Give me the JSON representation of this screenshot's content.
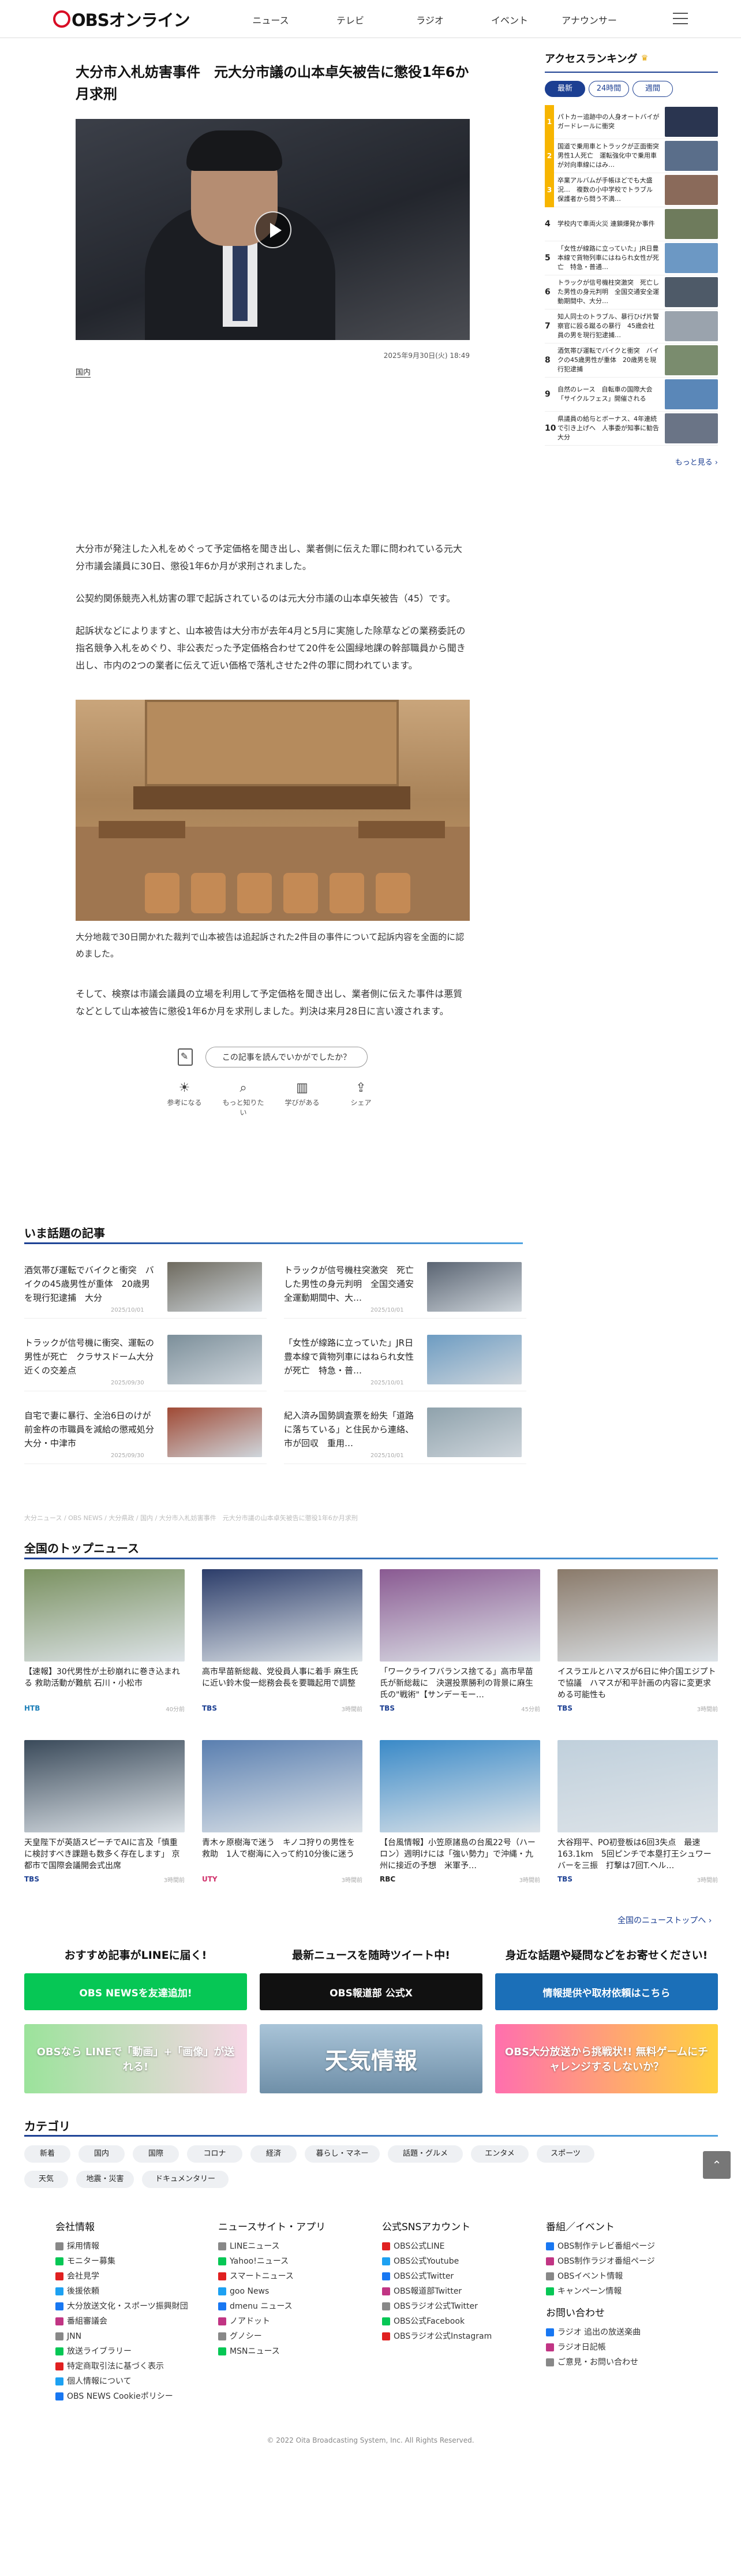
{
  "header": {
    "logo": "OBSオンライン",
    "nav": [
      "ニュース",
      "テレビ",
      "ラジオ",
      "イベント",
      "アナウンサー"
    ]
  },
  "article": {
    "title": "大分市入札妨害事件　元大分市議の山本卓矢被告に懲役1年6か月求刑",
    "date": "2025年9月30日(火) 18:49",
    "category": "国内",
    "paragraphs": [
      "大分市が発注した入札をめぐって予定価格を聞き出し、業者側に伝えた罪に問われている元大分市議会議員に30日、懲役1年6か月が求刑されました。",
      "公契約関係競売入札妨害の罪で起訴されているのは元大分市議の山本卓矢被告（45）です。",
      "起訴状などによりますと、山本被告は大分市が去年4月と5月に実施した除草などの業務委託の指名競争入札をめぐり、非公表だった予定価格合わせて20件を公園緑地課の幹部職員から聞き出し、市内の2つの業者に伝えて近い価格で落札させた2件の罪に問われています。"
    ],
    "caption": "大分地裁で30日開かれた裁判で山本被告は追起訴された2件目の事件について起訴内容を全面的に認めました。",
    "paragraph_last": "そして、検察は市議会議員の立場を利用して予定価格を聞き出し、業者側に伝えた事件は悪質などとして山本被告に懲役1年6か月を求刑しました。判決は来月28日に言い渡されます。",
    "feedback_prompt": "この記事を読んでいかがでしたか？",
    "reactions": [
      "参考になる",
      "もっと知りたい",
      "学びがある",
      "シェア"
    ]
  },
  "sidebar": {
    "title": "アクセスランキング",
    "tabs": [
      "最新",
      "24時間",
      "週間"
    ],
    "items": [
      {
        "rank": "1",
        "text": "パトカー追跡中の人身オートバイがガードレールに衝突",
        "color": "#2a3550"
      },
      {
        "rank": "2",
        "text": "国道で乗用車とトラックが正面衝突　男性1人死亡　運転強化中で乗用車が対向車線にはみ…",
        "color": "#5a6e8a"
      },
      {
        "rank": "3",
        "text": "卒業アルバムが手帳ほどでも大盛況…　複数の小中学校でトラブル　保護者から問う不満…",
        "color": "#8a6a5a"
      },
      {
        "rank": "4",
        "text": "学校内で車両火災 連鎖爆発か事件",
        "color": "#6e7b5c"
      },
      {
        "rank": "5",
        "text": "「女性が線路に立っていた」JR日豊本線で貨物列車にはねられ女性が死亡　特急・普通…",
        "color": "#6c98c4"
      },
      {
        "rank": "6",
        "text": "トラックが信号機柱突激突　死亡した男性の身元判明　全国交通安全運動期間中、大分…",
        "color": "#4e5a68"
      },
      {
        "rank": "7",
        "text": "知人同士のトラブル、暴行ひげ片警察官に殴る蹴るの暴行　45歳会社員の男を現行犯逮捕…",
        "color": "#9aa3ad"
      },
      {
        "rank": "8",
        "text": "酒気帯び運転でバイクと衝突　バイクの45歳男性が重体　20歳男を現行犯逮捕",
        "color": "#7a8c6e"
      },
      {
        "rank": "9",
        "text": "自然のレース　自転車の国際大会「サイクルフェス」開催される",
        "color": "#5a87b8"
      },
      {
        "rank": "10",
        "text": "県議員の給与とボーナス、4年連続で引き上げへ　人事委が知事に勧告　大分",
        "color": "#6a7486"
      }
    ],
    "more": "もっと見る ›"
  },
  "trending": {
    "title": "いま話題の記事",
    "items": [
      {
        "text": "酒気帯び運転でバイクと衝突　バイクの45歳男性が重体　20歳男を現行犯逮捕　大分",
        "date": "2025/10/01",
        "color": "#6e6a5e"
      },
      {
        "text": "トラックが信号機柱突激突　死亡した男性の身元判明　全国交通安全運動期間中、大…",
        "date": "2025/10/01",
        "color": "#5a6472"
      },
      {
        "text": "トラックが信号機に衝突、運転の男性が死亡　クラサスドーム大分近くの交差点",
        "date": "2025/09/30",
        "color": "#7c8f9a"
      },
      {
        "text": "「女性が線路に立っていた」JR日豊本線で貨物列車にはねられ女性が死亡　特急・普…",
        "date": "2025/10/01",
        "color": "#6d9cc2"
      },
      {
        "text": "自宅で妻に暴行、全治6日のけが　前金杵の市職員を減給の懲戒処分　大分・中津市",
        "date": "2025/09/30",
        "color": "#a04a35"
      },
      {
        "text": "紀入済み国勢調査票を紛失「道路に落ちている」と住民から連絡、市が回収　重用…",
        "date": "2025/10/01",
        "color": "#8fa2ac"
      }
    ]
  },
  "breadcrumb": "大分ニュース / OBS NEWS / 大分県政 / 国内 / 大分市入札妨害事件　元大分市議の山本卓矢被告に懲役1年6か月求刑",
  "top_news": {
    "title": "全国のトップニュース",
    "items": [
      {
        "text": "【速報】30代男性が土砂崩れに巻き込まれる 救助活動が難航 石川・小松市",
        "src": "HTB",
        "src_color": "#1c7fb8",
        "time": "40分前",
        "color": "#7a9160"
      },
      {
        "text": "高市早苗新総裁、党役員人事に着手 麻生氏に近い鈴木俊一総務会長を要職起用で調整",
        "src": "TBS",
        "src_color": "#1c3f92",
        "time": "3時間前",
        "color": "#2c3d6a"
      },
      {
        "text": "「ワークライフバランス捨てる」高市早苗氏が新総裁に　決選投票勝利の背景に麻生氏の\"戦術\"【サンデーモー…",
        "src": "TBS",
        "src_color": "#1c3f92",
        "time": "45分前",
        "color": "#8a5a92"
      },
      {
        "text": "イスラエルとハマスが6日に仲介国エジプトで協議　ハマスが和平計画の内容に変更求める可能性も",
        "src": "TBS",
        "src_color": "#1c3f92",
        "time": "3時間前",
        "color": "#8a7a6a"
      },
      {
        "text": "天皇陛下が英語スピーチでAIに言及「慎重に検討すべき課題も数多く存在します」 京都市で国際会議開会式出席",
        "src": "TBS",
        "src_color": "#1c3f92",
        "time": "3時間前",
        "color": "#3a4a5a"
      },
      {
        "text": "青木ヶ原樹海で迷う　キノコ狩りの男性を救助　1人で樹海に入って約10分後に迷う",
        "src": "UTY",
        "src_color": "#d0306a",
        "time": "3時間前",
        "color": "#5a7fb0"
      },
      {
        "text": "【台風情報】小笠原諸島の台風22号（ハーロン）週明けには「強い勢力」で沖縄・九州に接近の予想　米軍予…",
        "src": "RBC",
        "src_color": "#222222",
        "time": "3時間前",
        "color": "#3a8ac8"
      },
      {
        "text": "大谷翔平、PO初登板は6回3失点　最速163.1km　5回ピンチで本塁打王シュワーバーを三振　打撃は7回T.ヘル…",
        "src": "TBS",
        "src_color": "#1c3f92",
        "time": "3時間前",
        "color": "#c0d0dc"
      }
    ],
    "all_link": "全国のニューストップへ ›"
  },
  "promos": [
    {
      "head": "おすすめ記事がLINEに届く!",
      "button": "OBS NEWSを友達追加!",
      "color": "#06c755"
    },
    {
      "head": "最新ニュースを随時ツイート中!",
      "button": "OBS報道部 公式X",
      "color": "#111111"
    },
    {
      "head": "身近な話題や疑問などをお寄せください!",
      "button": "情報提供や取材依頼はこちら",
      "color": "#1b6fb8"
    }
  ],
  "banners": [
    "OBSなら LINEで「動画」+「画像」が送れる!",
    "天気情報",
    "OBS大分放送から挑戦状!! 無料ゲームにチャレンジするしないか？"
  ],
  "categories": {
    "title": "カテゴリ",
    "items": [
      "新着",
      "国内",
      "国際",
      "コロナ",
      "経済",
      "暮らし・マネー",
      "話題・グルメ",
      "エンタメ",
      "スポーツ",
      "天気",
      "地震・災害",
      "ドキュメンタリー"
    ]
  },
  "footer": {
    "company": {
      "head": "会社情報",
      "links": [
        "採用情報",
        "モニター募集",
        "会社見学",
        "後援依頼",
        "大分放送文化・スポーツ振興財団",
        "番組審議会",
        "JNN",
        "放送ライブラリー",
        "特定商取引法に基づく表示",
        "個人情報について",
        "OBS NEWS Cookieポリシー"
      ]
    },
    "apps": {
      "head": "ニュースサイト・アプリ",
      "links": [
        "LINEニュース",
        "Yahoo!ニュース",
        "スマートニュース",
        "goo News",
        "dmenu ニュース",
        "ノアドット",
        "グノシー",
        "MSNニュース"
      ]
    },
    "sns": {
      "head": "公式SNSアカウント",
      "links": [
        "OBS公式LINE",
        "OBS公式Youtube",
        "OBS公式Twitter",
        "OBS報道部Twitter",
        "OBSラジオ公式Twitter",
        "OBS公式Facebook",
        "OBSラジオ公式Instagram"
      ]
    },
    "programs": {
      "head": "番組／イベント",
      "links": [
        "OBS制作テレビ番組ページ",
        "OBS制作ラジオ番組ページ",
        "OBSイベント情報",
        "キャンペーン情報"
      ]
    },
    "contact": {
      "head": "お問い合わせ",
      "links": [
        "ラジオ 追出の放送楽曲",
        "ラジオ日記帳",
        "ご意見・お問い合わせ"
      ]
    },
    "copyright": "© 2022 Oita Broadcasting System, Inc. All Rights Reserved."
  }
}
